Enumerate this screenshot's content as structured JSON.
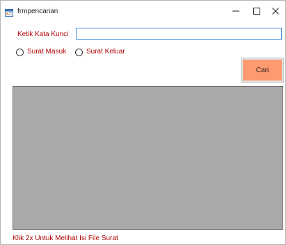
{
  "window": {
    "title": "frmpencarian",
    "app_icon": "form-app-icon",
    "controls": {
      "minimize_icon": "minimize-icon",
      "maximize_icon": "maximize-icon",
      "close_icon": "close-icon"
    }
  },
  "form": {
    "keyword_label": "Ketik Kata Kunci",
    "keyword_value": "",
    "radio_options": [
      {
        "label": "Surat Masuk",
        "selected": false
      },
      {
        "label": "Surat Keluar",
        "selected": false
      }
    ],
    "search_button_label": "Cari",
    "results_grid": {
      "rows": []
    },
    "footer_hint": "Klik 2x Untuk Melihat Isi File Surat"
  },
  "colors": {
    "label_text": "#b00000",
    "search_button_bg": "#ff9a70",
    "grid_bg": "#a9a9a9",
    "input_border": "#4a90d9"
  }
}
